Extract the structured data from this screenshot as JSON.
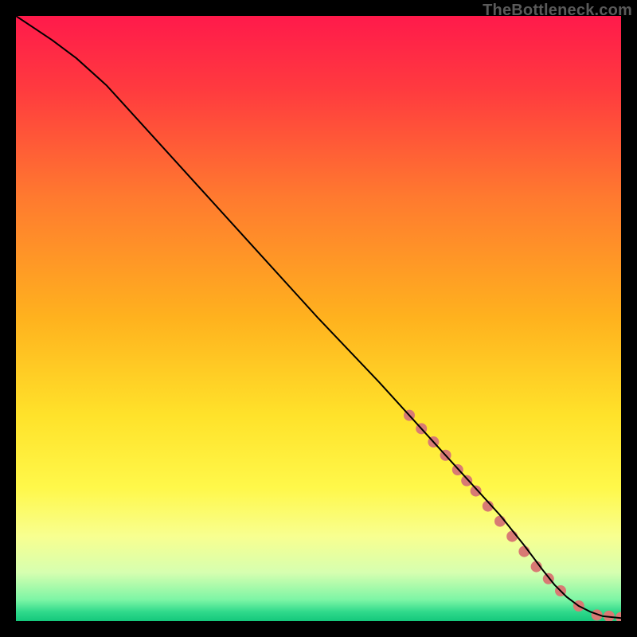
{
  "watermark": "TheBottleneck.com",
  "chart_data": {
    "type": "line",
    "title": "",
    "xlabel": "",
    "ylabel": "",
    "xlim": [
      0,
      100
    ],
    "ylim": [
      0,
      100
    ],
    "grid": false,
    "legend": false,
    "background_gradient_stops": [
      {
        "pct": 0,
        "color": "#ff1a4b"
      },
      {
        "pct": 12,
        "color": "#ff3a3f"
      },
      {
        "pct": 30,
        "color": "#ff7a2f"
      },
      {
        "pct": 50,
        "color": "#ffb21e"
      },
      {
        "pct": 66,
        "color": "#ffe22a"
      },
      {
        "pct": 78,
        "color": "#fff84a"
      },
      {
        "pct": 86,
        "color": "#f8ff90"
      },
      {
        "pct": 92,
        "color": "#d6ffb0"
      },
      {
        "pct": 96.5,
        "color": "#7cf5a5"
      },
      {
        "pct": 98.5,
        "color": "#2fd98b"
      },
      {
        "pct": 100,
        "color": "#15c87c"
      }
    ],
    "series": [
      {
        "name": "bottleneck-curve",
        "color": "#000000",
        "stroke_width": 2,
        "x": [
          0,
          3,
          6,
          10,
          15,
          20,
          30,
          40,
          50,
          60,
          65,
          70,
          75,
          80,
          84,
          87,
          89,
          91,
          93,
          95,
          97,
          100
        ],
        "y": [
          100,
          98,
          96,
          93,
          88.5,
          83,
          72,
          61,
          50,
          39.5,
          34,
          28.5,
          23,
          17.5,
          12.5,
          8.5,
          6,
          4,
          2.5,
          1.5,
          0.8,
          0.5
        ]
      }
    ],
    "highlight_points": {
      "name": "highlight-dots",
      "color": "#d87a74",
      "radius": 7,
      "x": [
        65,
        67,
        69,
        71,
        73,
        74.5,
        76,
        78,
        80,
        82,
        84,
        86,
        88,
        90,
        93,
        96,
        98,
        100
      ],
      "y": [
        34,
        31.8,
        29.6,
        27.4,
        25,
        23.2,
        21.5,
        19,
        16.5,
        14,
        11.5,
        9,
        7,
        5,
        2.5,
        1,
        0.8,
        0.6
      ]
    }
  }
}
